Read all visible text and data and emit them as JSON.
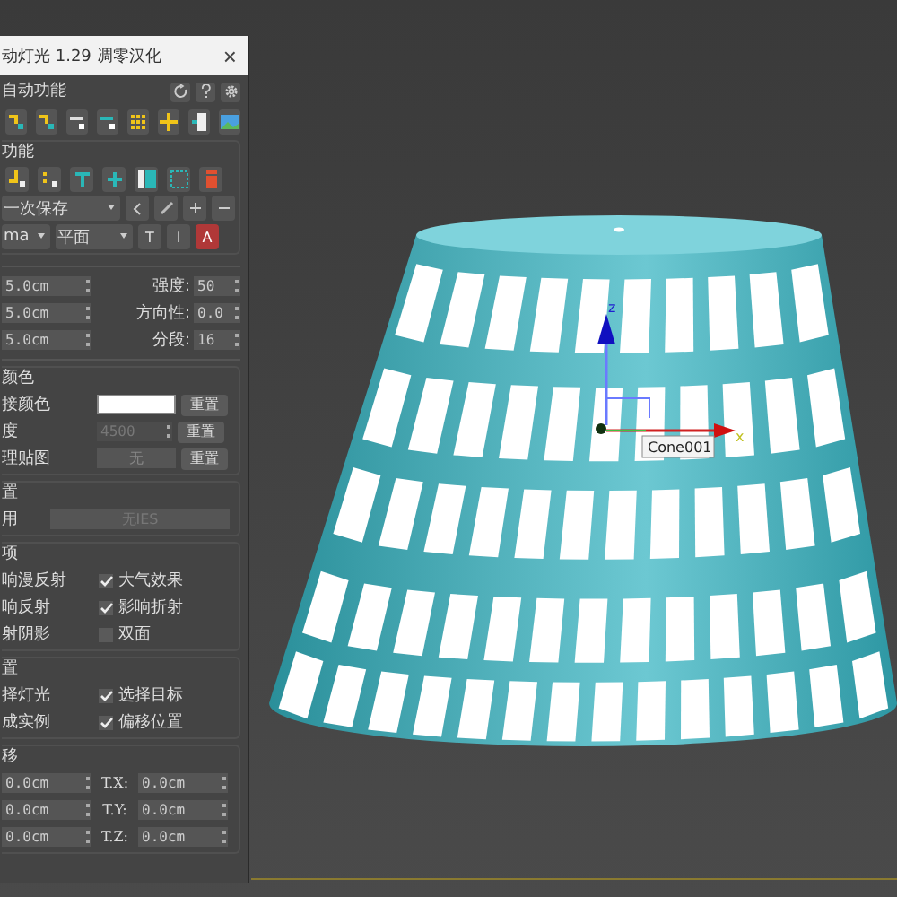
{
  "window": {
    "title": "动灯光 1.29 凋零汉化",
    "close": "×"
  },
  "auto": {
    "title": "自动功能"
  },
  "functions": {
    "title": "功能"
  },
  "preset": {
    "value": "一次保存"
  },
  "mode_row": {
    "value_1": "ma",
    "value_2": "平面",
    "buttons": [
      {
        "label": "T",
        "kind": "plain"
      },
      {
        "label": "I",
        "kind": "plain"
      },
      {
        "label": "A",
        "kind": "alert"
      }
    ]
  },
  "spinners_left": [
    "5.0cm",
    "5.0cm",
    "5.0cm"
  ],
  "spinners_right": [
    {
      "label": "强度:",
      "value": "50"
    },
    {
      "label": "方向性:",
      "value": "0.0"
    },
    {
      "label": "分段:",
      "value": "16"
    }
  ],
  "color": {
    "title": "颜色",
    "rows": [
      {
        "label": "接颜色",
        "kind": "swatch",
        "color": "#ffffff",
        "reset": "重置"
      },
      {
        "label": "度",
        "kind": "number",
        "value": "4500",
        "disabled": true,
        "reset": "重置"
      },
      {
        "label": "理贴图",
        "kind": "map",
        "value": "无",
        "reset": "重置"
      }
    ]
  },
  "ies": {
    "title": "置",
    "label": "用",
    "value": "无IES"
  },
  "options": {
    "title": "项",
    "rows": [
      {
        "left": "响漫反射",
        "right": {
          "label": "大气效果",
          "checked": true
        }
      },
      {
        "left": "响反射",
        "right": {
          "label": "影响折射",
          "checked": true
        }
      },
      {
        "left": "射阴影",
        "right": {
          "label": "双面",
          "checked": false
        }
      }
    ]
  },
  "selection": {
    "title": "置",
    "rows": [
      {
        "left": "择灯光",
        "right": {
          "label": "选择目标",
          "checked": true
        }
      },
      {
        "left": "成实例",
        "right": {
          "label": "偏移位置",
          "checked": true
        }
      }
    ]
  },
  "offset": {
    "title": "移",
    "rows": [
      {
        "value": "0.0cm",
        "label": "T.X:",
        "target": "0.0cm"
      },
      {
        "value": "0.0cm",
        "label": "T.Y:",
        "target": "0.0cm"
      },
      {
        "value": "0.0cm",
        "label": "T.Z:",
        "target": "0.0cm"
      }
    ]
  },
  "viewport": {
    "object_label": "Cone001",
    "axis_z": "z",
    "axis_x": "x"
  }
}
